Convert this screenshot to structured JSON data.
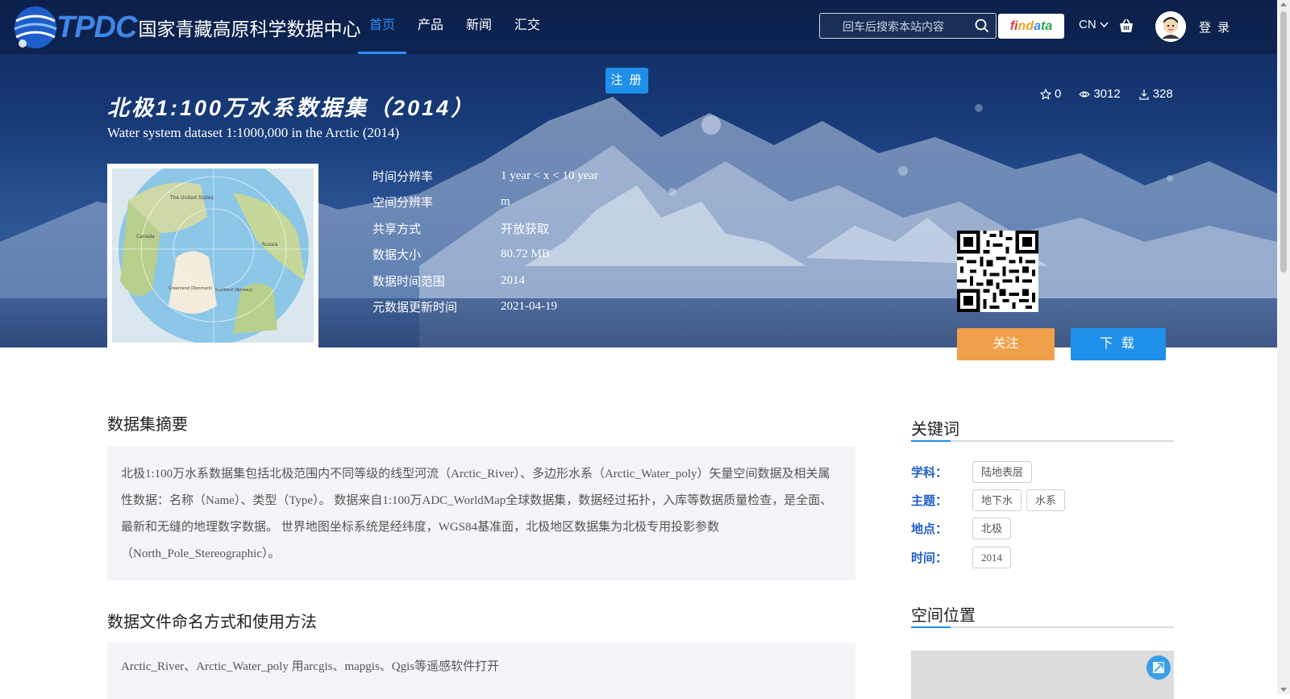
{
  "header": {
    "logo_abbr": "TPDC",
    "logo_name": "国家青藏高原科学数据中心",
    "nav": [
      "首页",
      "产品",
      "新闻",
      "汇交"
    ],
    "search_placeholder": "回车后搜索本站内容",
    "findata": [
      "fi",
      "nd",
      "a",
      "ta"
    ],
    "lang": "CN",
    "login": "登 录"
  },
  "register_label": "注 册",
  "dataset": {
    "title": "北极1:100万水系数据集（2014）",
    "subtitle": "Water system dataset 1:1000,000 in the Arctic (2014)",
    "stats": {
      "stars": "0",
      "views": "3012",
      "downloads": "328"
    },
    "meta": [
      {
        "key": "时间分辨率",
        "value": "1 year < x < 10 year"
      },
      {
        "key": "空间分辨率",
        "value": "m"
      },
      {
        "key": "共享方式",
        "value": "开放获取"
      },
      {
        "key": "数据大小",
        "value": "80.72 MB"
      },
      {
        "key": "数据时间范围",
        "value": "2014"
      },
      {
        "key": "元数据更新时间",
        "value": "2021-04-19"
      }
    ],
    "thumbnail_labels": [
      "The United States",
      "Canada",
      "Russia",
      "Greenland (Denmark)",
      "Svalbard (Norway)"
    ],
    "follow_label": "关注",
    "download_label": "下 载"
  },
  "abstract": {
    "title": "数据集摘要",
    "text": "北极1:100万水系数据集包括北极范围内不同等级的线型河流（Arctic_River）、多边形水系（Arctic_Water_poly）矢量空间数据及相关属性数据：名称（Name）、类型（Type）。 数据来自1:100万ADC_WorldMap全球数据集，数据经过拓扑，入库等数据质量检查，是全面、最新和无缝的地理数字数据。 世界地图坐标系统是经纬度，WGS84基准面，北极地区数据集为北极专用投影参数（North_Pole_Stereographic）。"
  },
  "naming": {
    "title": "数据文件命名方式和使用方法",
    "text": "Arctic_River、Arctic_Water_poly 用arcgis、mapgis、Qgis等遥感软件打开"
  },
  "keywords": {
    "title": "关键词",
    "rows": [
      {
        "label": "学科：",
        "tags": [
          "陆地表层"
        ]
      },
      {
        "label": "主题：",
        "tags": [
          "地下水",
          "水系"
        ]
      },
      {
        "label": "地点：",
        "tags": [
          "北极"
        ]
      },
      {
        "label": "时间：",
        "tags": [
          "2014"
        ]
      }
    ]
  },
  "spatial": {
    "title": "空间位置"
  },
  "colors": {
    "accent": "#1e90ea",
    "follow": "#f0a04b",
    "nav_active": "#2f8cf5",
    "keyword_label": "#1e5ec8"
  },
  "icons": [
    "globe-logo-icon",
    "search-icon",
    "cart-icon",
    "avatar-icon",
    "star-icon",
    "eye-icon",
    "download-icon",
    "qr-code-icon",
    "fullscreen-icon"
  ]
}
